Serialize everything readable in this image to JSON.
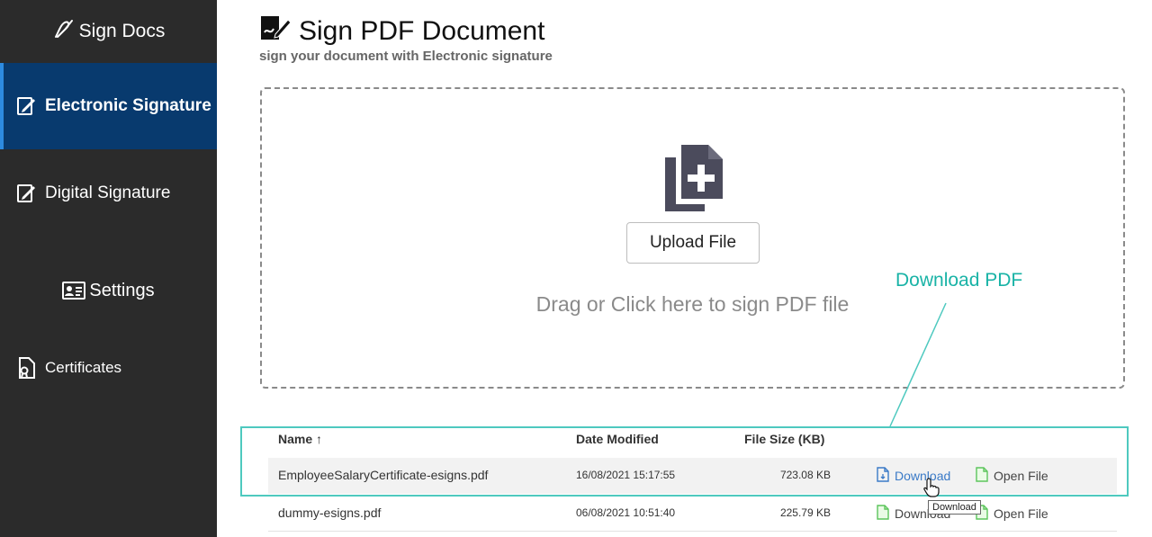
{
  "sidebar": {
    "brand": "Sign Docs",
    "items": [
      {
        "label": "Electronic Signature",
        "icon": "pen-document-icon",
        "active": true
      },
      {
        "label": "Digital Signature",
        "icon": "pen-document-icon",
        "active": false
      },
      {
        "label": "Settings",
        "icon": "id-card-icon",
        "active": false
      },
      {
        "label": "Certificates",
        "icon": "certificate-icon",
        "active": false
      }
    ]
  },
  "header": {
    "title": "Sign PDF Document",
    "subtitle": "sign your document with Electronic signature"
  },
  "dropzone": {
    "upload_label": "Upload File",
    "drag_text": "Drag or Click here to sign PDF file"
  },
  "annotation": {
    "label": "Download PDF",
    "color": "#19b3a6"
  },
  "table": {
    "columns": [
      "Name ↑",
      "Date Modified",
      "File Size (KB)"
    ],
    "rows": [
      {
        "name": "EmployeeSalaryCertificate-esigns.pdf",
        "date": "16/08/2021 15:17:55",
        "size": "723.08 KB",
        "download": "Download",
        "open": "Open File"
      },
      {
        "name": "dummy-esigns.pdf",
        "date": "06/08/2021 10:51:40",
        "size": "225.79 KB",
        "download": "Download",
        "open": "Open File"
      }
    ],
    "tooltip": "Download"
  },
  "colors": {
    "sidebar_bg": "#2b2b2b",
    "active_bg": "#083a6e",
    "accent": "#2d8be0",
    "link_blue": "#3a7ac7",
    "file_green": "#5cc55c"
  }
}
